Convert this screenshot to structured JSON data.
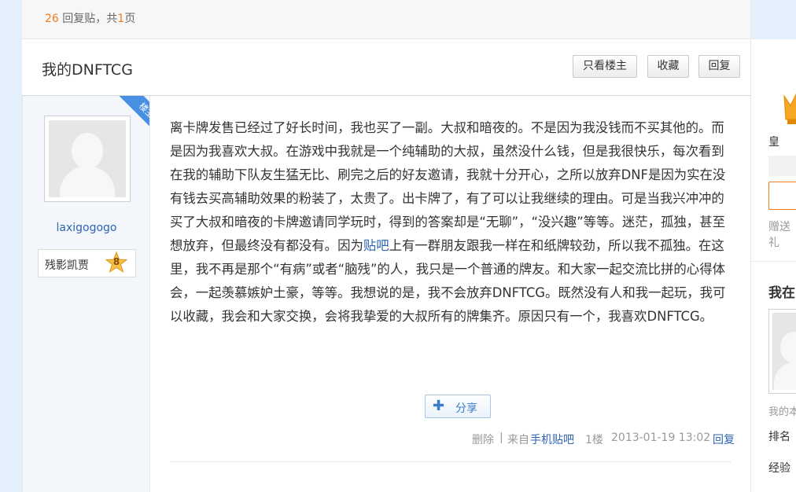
{
  "header": {
    "reply_count": "26",
    "reply_label": "回复贴，共",
    "page_count": "1",
    "page_unit": "页"
  },
  "thread": {
    "title": "我的DNFTCG",
    "buttons": {
      "only_op": "只看楼主",
      "favorite": "收藏",
      "reply": "回复"
    }
  },
  "post": {
    "op_ribbon": "楼主",
    "author": {
      "name": "laxigogogo",
      "badge_name": "残影凯贾",
      "level": "8"
    },
    "text_part1": "离卡牌发售已经过了好长时间，我也买了一副。大叔和暗夜的。不是因为我没钱而不买其他的。而是因为我喜欢大叔。在游戏中我就是一个纯辅助的大叔，虽然没什么钱，但是我很快乐，每次看到在我的辅助下队友生猛无比、刷完之后的好友邀请，我就十分开心，之所以放弃DNF是因为实在没有钱去买高辅助效果的粉装了，太贵了。出卡牌了，有了可以让我继续的理由。可是当我兴冲冲的买了大叔和暗夜的卡牌邀请同学玩时，得到的答案却是“无聊”，“没兴趣”等等。迷茫，孤独，甚至想放弃，但最终没有都没有。因为",
    "text_link": "贴吧",
    "text_part2": "上有一群朋友跟我一样在和纸牌较劲，所以我不孤独。在这里，我不再是那个“有病”或者“脑残”的人，我只是一个普通的牌友。和大家一起交流比拼的心得体会，一起羡慕嫉妒土豪，等等。我想说的是，我不会放弃DNFTCG。既然没有人和我一起玩，我可以收藏，我会和大家交换，会将我挚爱的大叔所有的牌集齐。原因只有一个，我喜欢DNFTCG。",
    "share_label": "分享",
    "meta": {
      "delete": "删除",
      "separator": "|",
      "from": "来自",
      "client": "手机贴吧",
      "floor": "1楼",
      "time": "2013-01-19 13:02",
      "reply": "回复"
    }
  },
  "sidebar": {
    "label_huang": "皇",
    "send_label": "赠送礼",
    "section_title": "我在",
    "my_label": "我的本",
    "rank_label": "排名",
    "exp_label": "经验"
  },
  "colors": {
    "accent_orange": "#f07d22",
    "link_blue": "#2d64b3",
    "page_bg": "#e3f0fb"
  }
}
